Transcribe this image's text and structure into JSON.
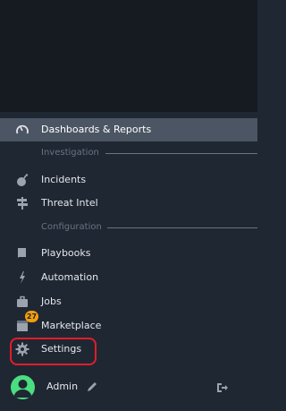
{
  "nav": {
    "dashboards": "Dashboards & Reports",
    "section_investigation": "Investigation",
    "incidents": "Incidents",
    "threat_intel": "Threat Intel",
    "section_configuration": "Configuration",
    "playbooks": "Playbooks",
    "automation": "Automation",
    "jobs": "Jobs",
    "marketplace": "Marketplace",
    "marketplace_badge": "27",
    "settings": "Settings"
  },
  "user": {
    "name": "Admin"
  },
  "colors": {
    "background": "#1f2733",
    "active_item": "#4b5563",
    "badge": "#f59e0b",
    "highlight": "#e11d2a",
    "avatar": "#4ade80"
  },
  "icons": {
    "dashboards": "gauge-icon",
    "incidents": "bomb-icon",
    "threat_intel": "signpost-icon",
    "playbooks": "book-icon",
    "automation": "lightning-icon",
    "jobs": "briefcase-icon",
    "marketplace": "store-icon",
    "settings": "gear-icon",
    "edit": "pencil-icon",
    "logout": "sign-out-icon"
  }
}
